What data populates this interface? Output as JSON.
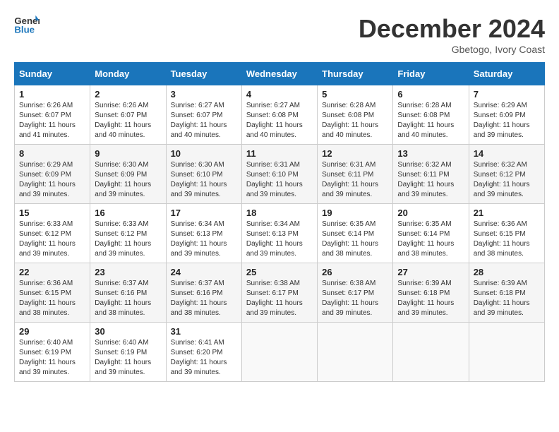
{
  "header": {
    "logo_line1": "General",
    "logo_line2": "Blue",
    "month_title": "December 2024",
    "location": "Gbetogo, Ivory Coast"
  },
  "calendar": {
    "days_of_week": [
      "Sunday",
      "Monday",
      "Tuesday",
      "Wednesday",
      "Thursday",
      "Friday",
      "Saturday"
    ],
    "weeks": [
      [
        {
          "day": "",
          "info": ""
        },
        {
          "day": "2",
          "info": "Sunrise: 6:26 AM\nSunset: 6:07 PM\nDaylight: 11 hours\nand 40 minutes."
        },
        {
          "day": "3",
          "info": "Sunrise: 6:27 AM\nSunset: 6:07 PM\nDaylight: 11 hours\nand 40 minutes."
        },
        {
          "day": "4",
          "info": "Sunrise: 6:27 AM\nSunset: 6:08 PM\nDaylight: 11 hours\nand 40 minutes."
        },
        {
          "day": "5",
          "info": "Sunrise: 6:28 AM\nSunset: 6:08 PM\nDaylight: 11 hours\nand 40 minutes."
        },
        {
          "day": "6",
          "info": "Sunrise: 6:28 AM\nSunset: 6:08 PM\nDaylight: 11 hours\nand 40 minutes."
        },
        {
          "day": "7",
          "info": "Sunrise: 6:29 AM\nSunset: 6:09 PM\nDaylight: 11 hours\nand 39 minutes."
        }
      ],
      [
        {
          "day": "8",
          "info": "Sunrise: 6:29 AM\nSunset: 6:09 PM\nDaylight: 11 hours\nand 39 minutes."
        },
        {
          "day": "9",
          "info": "Sunrise: 6:30 AM\nSunset: 6:09 PM\nDaylight: 11 hours\nand 39 minutes."
        },
        {
          "day": "10",
          "info": "Sunrise: 6:30 AM\nSunset: 6:10 PM\nDaylight: 11 hours\nand 39 minutes."
        },
        {
          "day": "11",
          "info": "Sunrise: 6:31 AM\nSunset: 6:10 PM\nDaylight: 11 hours\nand 39 minutes."
        },
        {
          "day": "12",
          "info": "Sunrise: 6:31 AM\nSunset: 6:11 PM\nDaylight: 11 hours\nand 39 minutes."
        },
        {
          "day": "13",
          "info": "Sunrise: 6:32 AM\nSunset: 6:11 PM\nDaylight: 11 hours\nand 39 minutes."
        },
        {
          "day": "14",
          "info": "Sunrise: 6:32 AM\nSunset: 6:12 PM\nDaylight: 11 hours\nand 39 minutes."
        }
      ],
      [
        {
          "day": "15",
          "info": "Sunrise: 6:33 AM\nSunset: 6:12 PM\nDaylight: 11 hours\nand 39 minutes."
        },
        {
          "day": "16",
          "info": "Sunrise: 6:33 AM\nSunset: 6:12 PM\nDaylight: 11 hours\nand 39 minutes."
        },
        {
          "day": "17",
          "info": "Sunrise: 6:34 AM\nSunset: 6:13 PM\nDaylight: 11 hours\nand 39 minutes."
        },
        {
          "day": "18",
          "info": "Sunrise: 6:34 AM\nSunset: 6:13 PM\nDaylight: 11 hours\nand 39 minutes."
        },
        {
          "day": "19",
          "info": "Sunrise: 6:35 AM\nSunset: 6:14 PM\nDaylight: 11 hours\nand 38 minutes."
        },
        {
          "day": "20",
          "info": "Sunrise: 6:35 AM\nSunset: 6:14 PM\nDaylight: 11 hours\nand 38 minutes."
        },
        {
          "day": "21",
          "info": "Sunrise: 6:36 AM\nSunset: 6:15 PM\nDaylight: 11 hours\nand 38 minutes."
        }
      ],
      [
        {
          "day": "22",
          "info": "Sunrise: 6:36 AM\nSunset: 6:15 PM\nDaylight: 11 hours\nand 38 minutes."
        },
        {
          "day": "23",
          "info": "Sunrise: 6:37 AM\nSunset: 6:16 PM\nDaylight: 11 hours\nand 38 minutes."
        },
        {
          "day": "24",
          "info": "Sunrise: 6:37 AM\nSunset: 6:16 PM\nDaylight: 11 hours\nand 38 minutes."
        },
        {
          "day": "25",
          "info": "Sunrise: 6:38 AM\nSunset: 6:17 PM\nDaylight: 11 hours\nand 39 minutes."
        },
        {
          "day": "26",
          "info": "Sunrise: 6:38 AM\nSunset: 6:17 PM\nDaylight: 11 hours\nand 39 minutes."
        },
        {
          "day": "27",
          "info": "Sunrise: 6:39 AM\nSunset: 6:18 PM\nDaylight: 11 hours\nand 39 minutes."
        },
        {
          "day": "28",
          "info": "Sunrise: 6:39 AM\nSunset: 6:18 PM\nDaylight: 11 hours\nand 39 minutes."
        }
      ],
      [
        {
          "day": "29",
          "info": "Sunrise: 6:40 AM\nSunset: 6:19 PM\nDaylight: 11 hours\nand 39 minutes."
        },
        {
          "day": "30",
          "info": "Sunrise: 6:40 AM\nSunset: 6:19 PM\nDaylight: 11 hours\nand 39 minutes."
        },
        {
          "day": "31",
          "info": "Sunrise: 6:41 AM\nSunset: 6:20 PM\nDaylight: 11 hours\nand 39 minutes."
        },
        {
          "day": "",
          "info": ""
        },
        {
          "day": "",
          "info": ""
        },
        {
          "day": "",
          "info": ""
        },
        {
          "day": "",
          "info": ""
        }
      ]
    ],
    "first_week_day1": {
      "day": "1",
      "info": "Sunrise: 6:26 AM\nSunset: 6:07 PM\nDaylight: 11 hours\nand 41 minutes."
    }
  }
}
